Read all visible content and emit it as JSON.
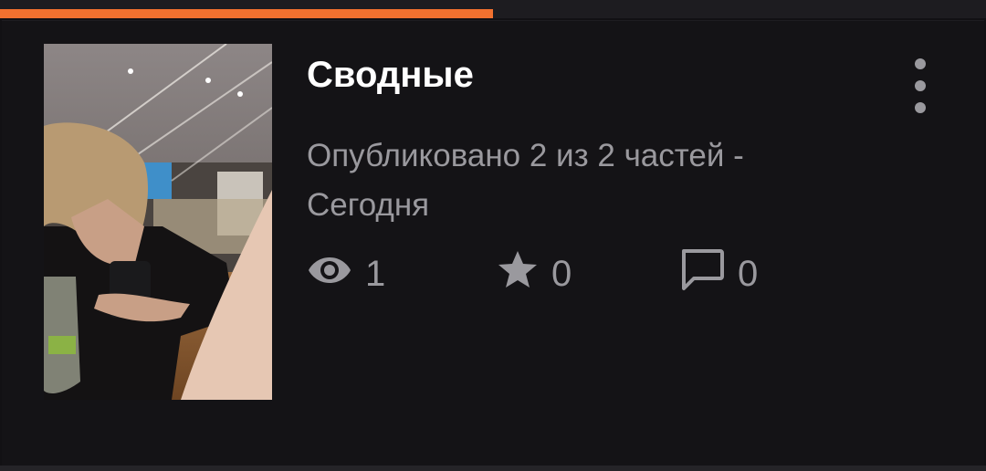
{
  "progress": {
    "fraction": 0.5,
    "color": "#f2712f"
  },
  "story": {
    "title": "Сводные",
    "meta": "Опубликовано 2 из 2 частей - Сегодня",
    "cover_description": "photo",
    "stats": {
      "views": "1",
      "votes": "0",
      "comments": "0"
    }
  },
  "icons": {
    "views": "eye-icon",
    "votes": "star-icon",
    "comments": "comment-icon",
    "menu": "more-vertical-icon"
  }
}
